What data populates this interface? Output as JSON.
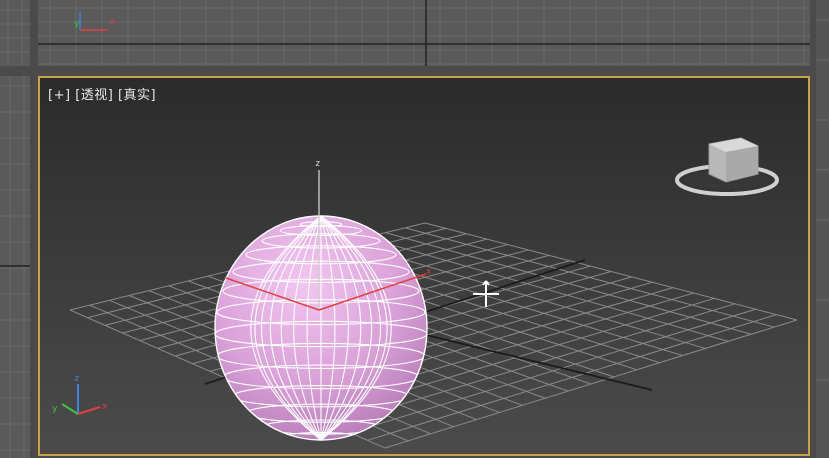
{
  "viewport": {
    "menu_plus": "[+]",
    "view_name": "[透视]",
    "shading_mode": "[真实]"
  },
  "axes": {
    "x": "x",
    "y": "y",
    "z": "z"
  },
  "colors": {
    "active_border": "#c9a24a",
    "sphere": "#d9a0d8",
    "wire": "#ffffff",
    "x_axis": "#e04040",
    "y_axis": "#40c040",
    "z_axis": "#4080e0"
  }
}
